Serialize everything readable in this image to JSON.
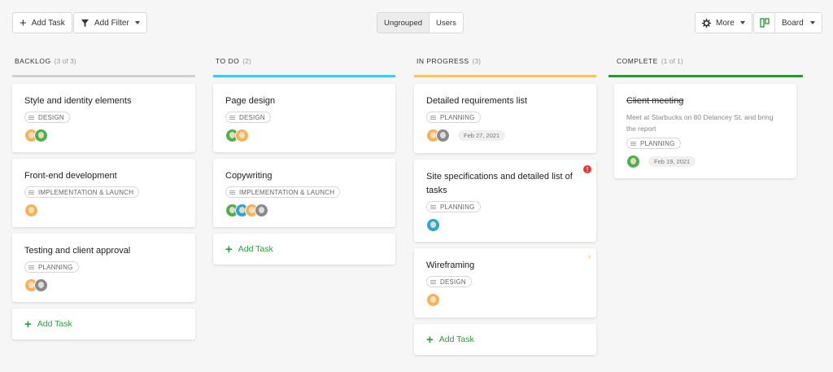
{
  "toolbar": {
    "add_task": "Add Task",
    "add_filter": "Add Filter",
    "ungrouped": "Ungrouped",
    "users": "Users",
    "more": "More",
    "board": "Board"
  },
  "colors": {
    "backlog": "#d0d0d0",
    "todo": "#4fc3e8",
    "in_progress": "#f5c36b",
    "complete": "#3a8f3a",
    "accent_green": "#2e9e3c"
  },
  "columns": {
    "backlog": {
      "title": "BACKLOG",
      "count": "(3 of 3)",
      "cards": [
        {
          "title": "Style and identity elements",
          "tag": "DESIGN"
        },
        {
          "title": "Front-end development",
          "tag": "IMPLEMENTATION & LAUNCH"
        },
        {
          "title": "Testing and client approval",
          "tag": "PLANNING"
        }
      ],
      "add": "Add Task"
    },
    "todo": {
      "title": "TO DO",
      "count": "(2)",
      "cards": [
        {
          "title": "Page design",
          "tag": "DESIGN"
        },
        {
          "title": "Copywriting",
          "tag": "IMPLEMENTATION & LAUNCH"
        }
      ],
      "add": "Add Task"
    },
    "in_progress": {
      "title": "IN PROGRESS",
      "count": "(3)",
      "cards": [
        {
          "title": "Detailed requirements list",
          "tag": "PLANNING",
          "date": "Feb 27, 2021"
        },
        {
          "title": "Site specifications and detailed list of tasks",
          "tag": "PLANNING",
          "flag": "!"
        },
        {
          "title": "Wireframing",
          "tag": "DESIGN",
          "flag": "↑"
        }
      ],
      "add": "Add Task"
    },
    "complete": {
      "title": "COMPLETE",
      "count": "(1 of 1)",
      "cards": [
        {
          "title": "Client meeting",
          "desc": "Meet at Starbucks on 80 Delancey St. and bring the report",
          "tag": "PLANNING",
          "date": "Feb 19, 2021"
        }
      ]
    }
  }
}
